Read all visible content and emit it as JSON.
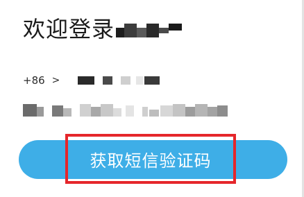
{
  "header": {
    "title": "欢迎登录"
  },
  "phone": {
    "country_code": "+86",
    "chevron": ">"
  },
  "actions": {
    "get_code_label": "获取短信验证码"
  },
  "colors": {
    "button": "#3eaee7",
    "highlight": "#e5262b",
    "text": "#1b1b1b"
  }
}
